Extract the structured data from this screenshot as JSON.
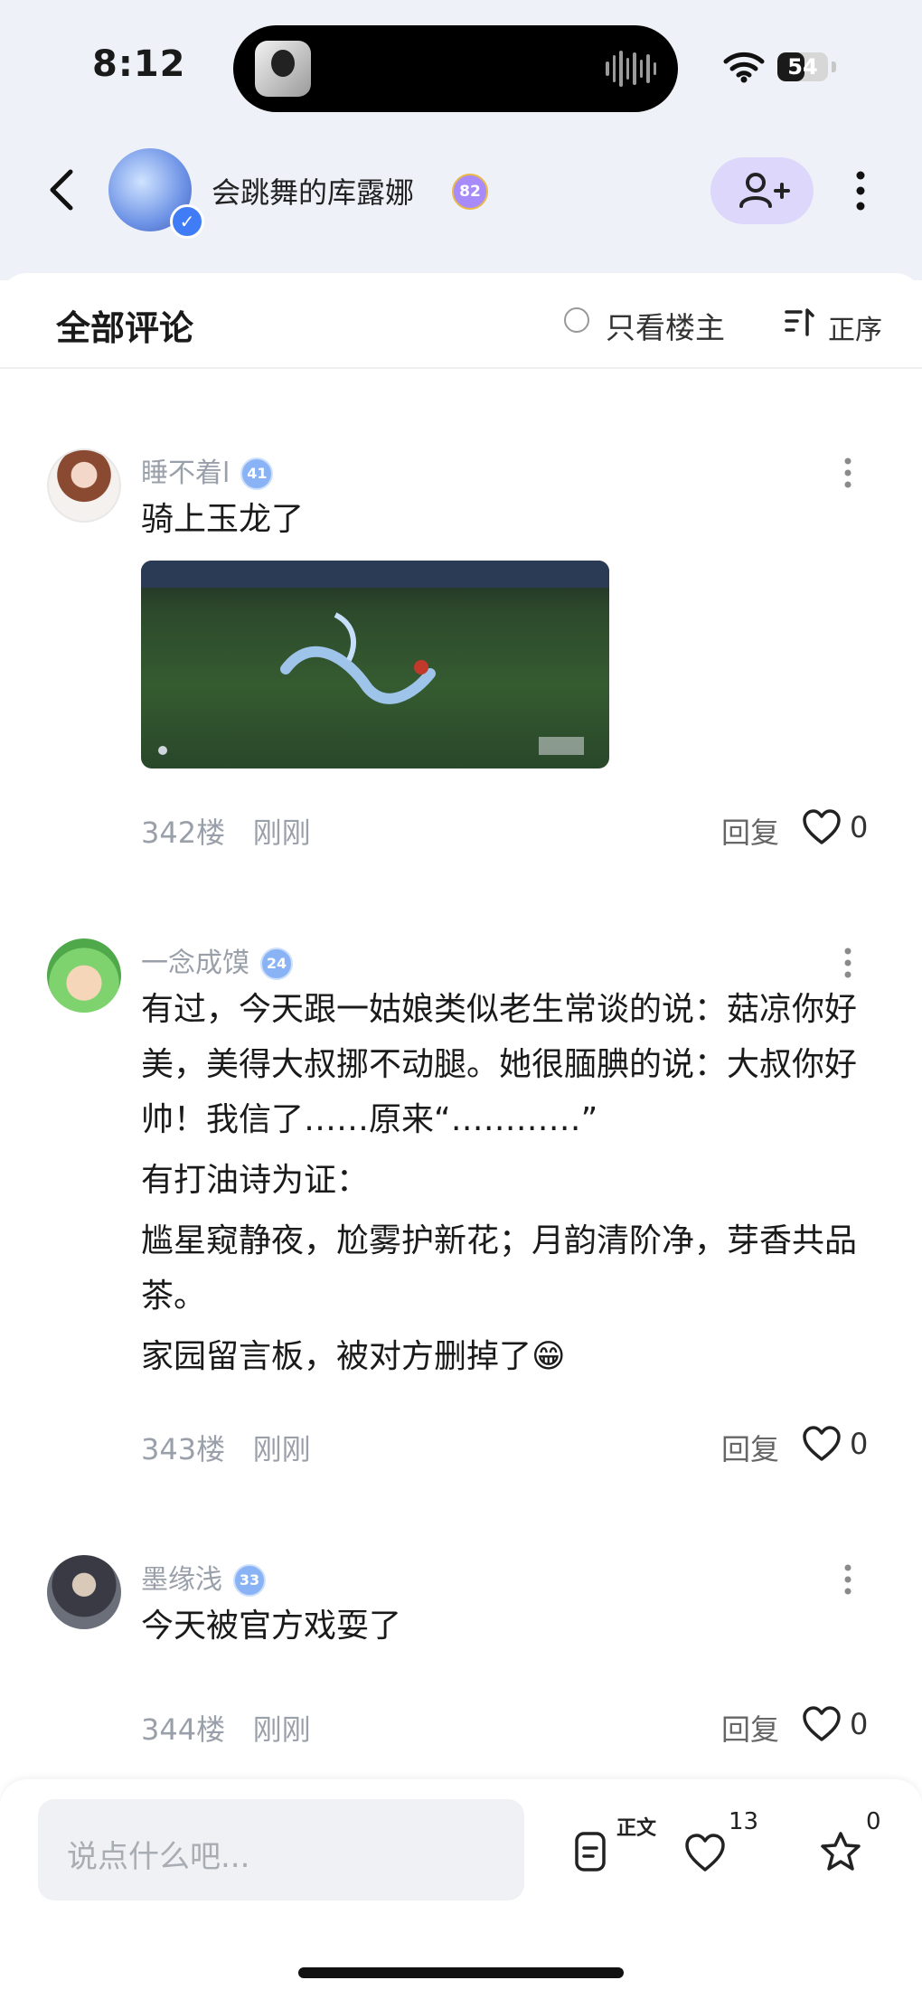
{
  "status_bar": {
    "time": "8:12",
    "battery": "54",
    "battery_level": 0.54
  },
  "nav": {
    "title": "会跳舞的库露娜",
    "level": "82",
    "verified": "✓"
  },
  "header": {
    "title": "全部评论",
    "only_host": "只看楼主",
    "sort": "正序"
  },
  "comments": [
    {
      "name": "睡不着l",
      "level": "41",
      "body": [
        "骑上玉龙了"
      ],
      "floor": "342楼",
      "time": "刚刚",
      "reply": "回复",
      "likes": "0"
    },
    {
      "name": "一念成馍",
      "level": "24",
      "body": [
        "有过，今天跟一姑娘类似老生常谈的说：菇凉你好美，美得大叔挪不动腿。她很腼腆的说：大叔你好帅！我信了……原来“…………”",
        "有打油诗为证：",
        "尴星窥静夜，尬雾护新花；月韵清阶净，芽香共品茶。",
        "家园留言板，被对方删掉了😁"
      ],
      "floor": "343楼",
      "time": "刚刚",
      "reply": "回复",
      "likes": "0"
    },
    {
      "name": "墨缘浅",
      "level": "33",
      "body": [
        "今天被官方戏耍了"
      ],
      "floor": "344楼",
      "time": "刚刚",
      "reply": "回复",
      "likes": "0"
    }
  ],
  "bottom_bar": {
    "placeholder": "说点什么吧...",
    "text_label": "正文",
    "like_count": "13",
    "star_count": "0"
  },
  "colors": {
    "accent": "#dcd7fb",
    "background": "#eef2f8",
    "muted": "#9aa0aa"
  },
  "icons": [
    "back-arrow-icon",
    "add-friend-icon",
    "more-vertical-icon",
    "sort-icon",
    "heart-icon",
    "star-icon",
    "document-icon",
    "wifi-icon",
    "battery-icon"
  ]
}
